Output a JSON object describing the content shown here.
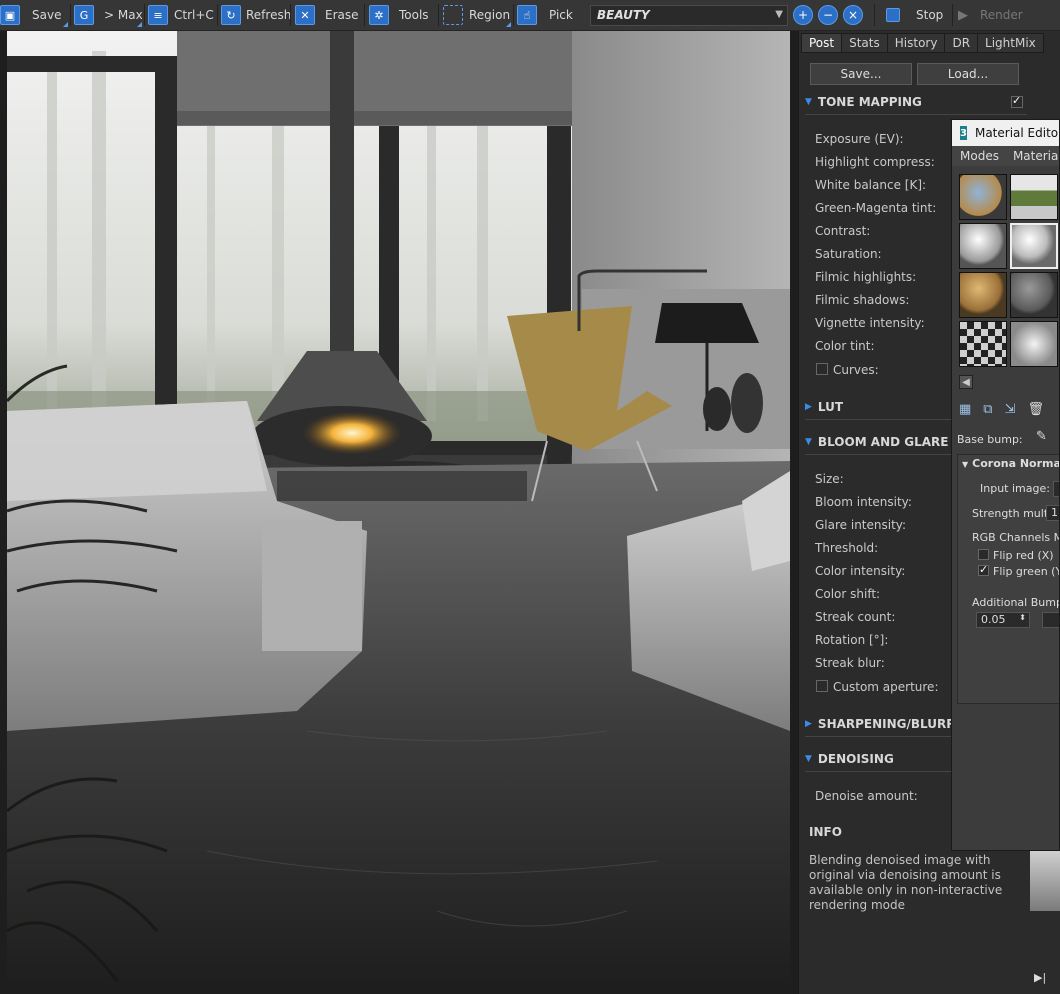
{
  "toolbar": {
    "save": "Save",
    "to_max": "> Max",
    "ctrl_c": "Ctrl+C",
    "refresh": "Refresh",
    "erase": "Erase",
    "tools": "Tools",
    "region": "Region",
    "pick": "Pick",
    "pass": "BEAUTY",
    "stop": "Stop",
    "render": "Render"
  },
  "panel": {
    "tabs": [
      "Post",
      "Stats",
      "History",
      "DR",
      "LightMix"
    ],
    "save_btn": "Save...",
    "load_btn": "Load...",
    "tone_mapping": {
      "title": "TONE MAPPING",
      "enabled": true,
      "rows": [
        "Exposure (EV):",
        "Highlight compress:",
        "White balance [K]:",
        "Green-Magenta tint:",
        "Contrast:",
        "Saturation:",
        "Filmic highlights:",
        "Filmic shadows:",
        "Vignette intensity:",
        "Color tint:"
      ],
      "curves": "Curves:"
    },
    "lut": {
      "title": "LUT"
    },
    "bloom": {
      "title": "BLOOM AND GLARE",
      "rows": [
        "Size:",
        "Bloom intensity:",
        "Glare intensity:",
        "Threshold:",
        "Color intensity:",
        "Color shift:",
        "Streak count:",
        "Rotation [°]:",
        "Streak blur:"
      ],
      "custom_aperture": "Custom aperture:"
    },
    "sharpening": {
      "title": "SHARPENING/BLURRING"
    },
    "denoising": {
      "title": "DENOISING",
      "amount": "Denoise amount:"
    },
    "info": {
      "title": "INFO",
      "text": "Blending denoised image with original via denoising amount is available only in non-interactive rendering mode"
    }
  },
  "material_editor": {
    "title": "Material Editor",
    "menu": [
      "Modes",
      "Material"
    ],
    "base_bump": "Base bump:",
    "rollout_title": "Corona Normal",
    "input_image": "Input image:",
    "strength_mult": "Strength mult:",
    "strength_value": "1",
    "rgb_channels": "RGB Channels Mapping",
    "flip_red": "Flip red (X)",
    "flip_red_checked": false,
    "flip_green": "Flip green (Y)",
    "flip_green_checked": true,
    "additional_bump": "Additional Bump Map",
    "additional_value": "0.05"
  },
  "colors": {
    "accent": "#3c8ce7",
    "toolbar_bg": "#363636",
    "panel_bg": "#2b2b2b"
  }
}
